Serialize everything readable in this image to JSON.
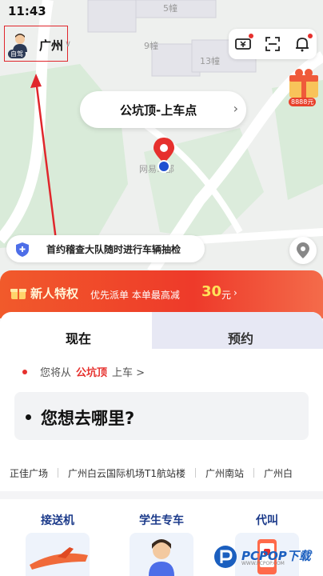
{
  "status_bar": {
    "time": "11:43"
  },
  "map": {
    "labels": [
      "5幢",
      "9幢",
      "13幢",
      "网易…部"
    ],
    "city": {
      "avatar_badge": "自驾",
      "name": "广州"
    },
    "promo_amount": "8888元"
  },
  "pickup": {
    "label": "公坑顶-上车点"
  },
  "notice": {
    "text": "首约稽查大队随时进行车辆抽检"
  },
  "banner": {
    "title": "新人特权",
    "subtitle": "优先派单 本单最高减",
    "amount": "30",
    "unit": "元"
  },
  "tabs": {
    "now": "现在",
    "reserve": "预约"
  },
  "from": {
    "prefix": "您将从",
    "place": "公坑顶",
    "suffix": "上车 >"
  },
  "destination": {
    "placeholder": "您想去哪里?"
  },
  "quick_places": [
    "正佳广场",
    "广州白云国际机场T1航站楼",
    "广州南站",
    "广州白"
  ],
  "services": [
    {
      "label": "接送机"
    },
    {
      "label": "学生专车"
    },
    {
      "label": "代叫"
    }
  ],
  "watermark": {
    "brand": "PCPOP下载",
    "sub": "WWW.PCPOP.COM"
  },
  "colors": {
    "accent_red": "#e6302d",
    "banner_red": "#ee3a2a",
    "service_blue": "#1b3a8a"
  }
}
